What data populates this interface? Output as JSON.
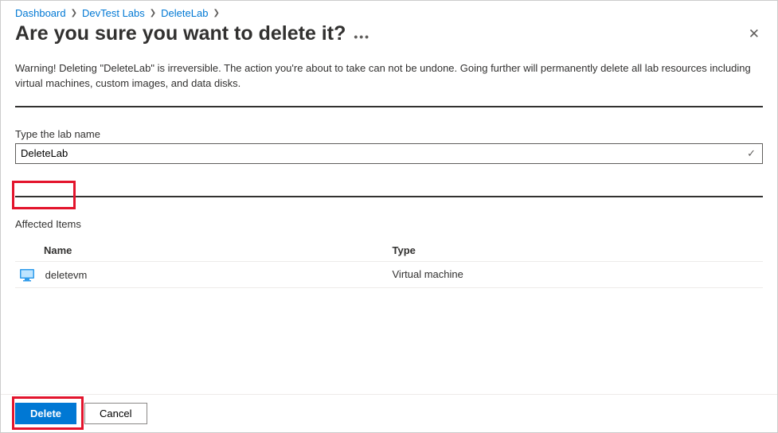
{
  "breadcrumb": {
    "items": [
      {
        "label": "Dashboard"
      },
      {
        "label": "DevTest Labs"
      },
      {
        "label": "DeleteLab"
      }
    ]
  },
  "header": {
    "title": "Are you sure you want to delete it?"
  },
  "warning": "Warning! Deleting \"DeleteLab\" is irreversible. The action you're about to take can not be undone. Going further will permanently delete all lab resources including virtual machines, custom images, and data disks.",
  "form": {
    "lab_name_label": "Type the lab name",
    "lab_name_value": "DeleteLab"
  },
  "affected": {
    "title": "Affected Items",
    "columns": {
      "name": "Name",
      "type": "Type"
    },
    "rows": [
      {
        "name": "deletevm",
        "type": "Virtual machine"
      }
    ]
  },
  "footer": {
    "delete_label": "Delete",
    "cancel_label": "Cancel"
  }
}
